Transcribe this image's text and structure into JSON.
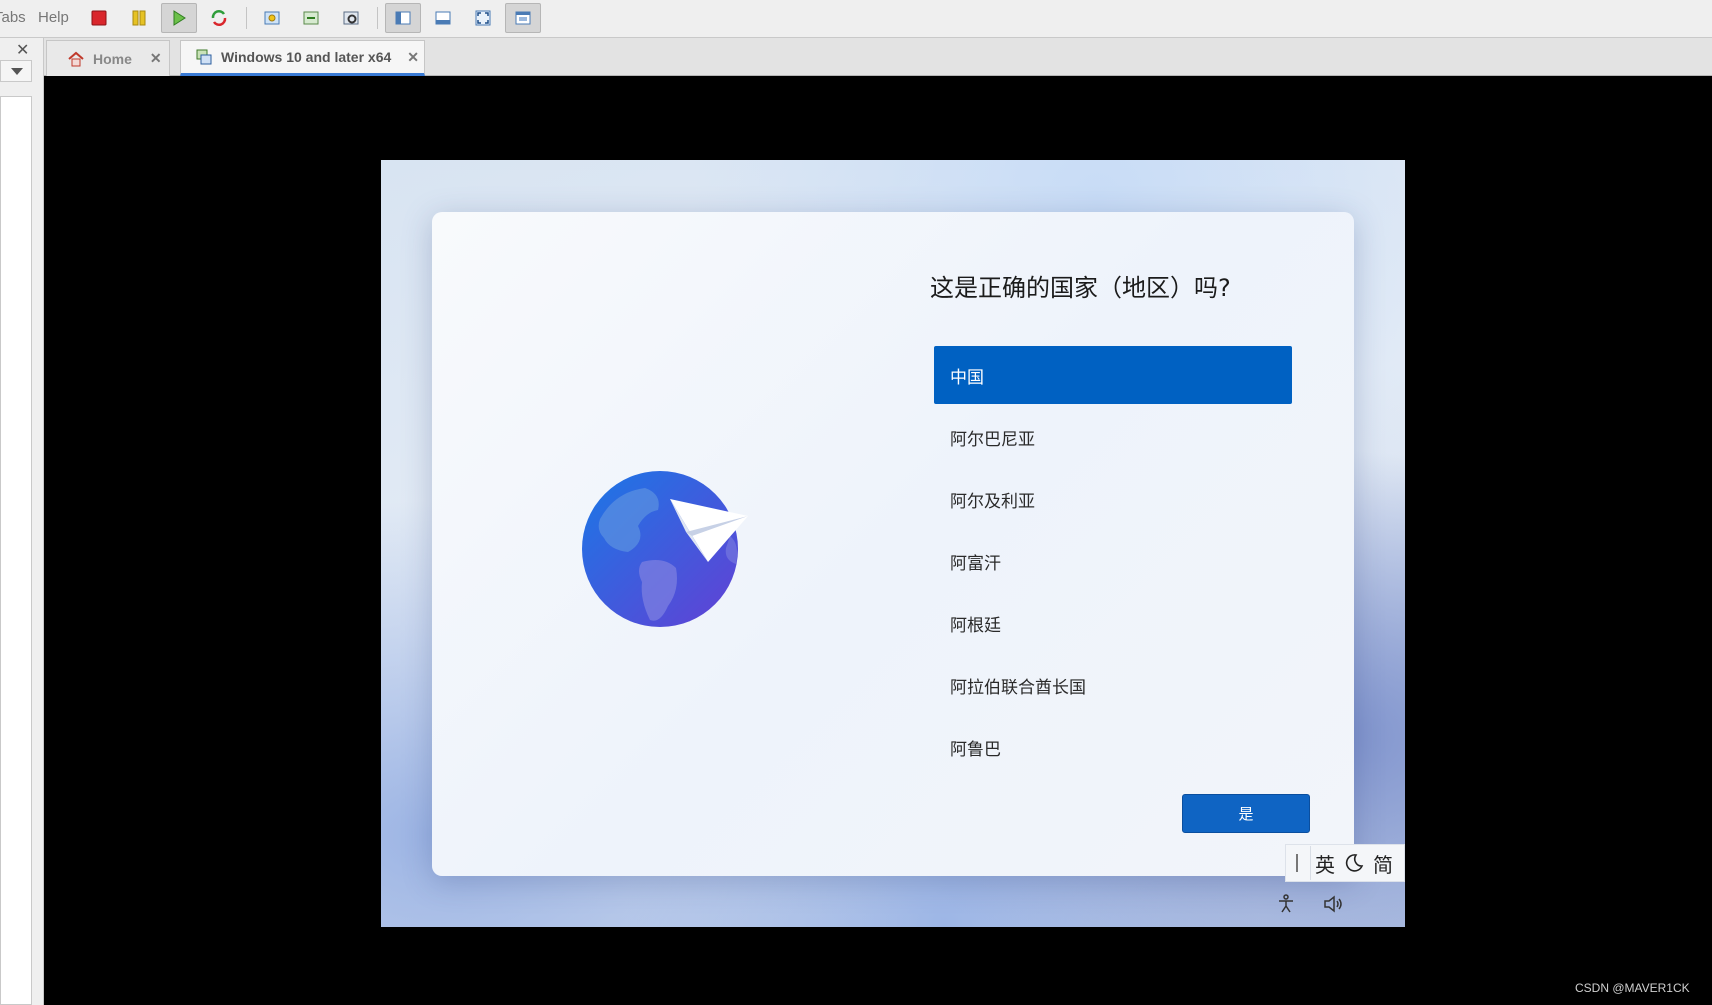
{
  "menu": {
    "tabs_label": "Tabs",
    "help_label": "Help"
  },
  "toolbar_icons": [
    "stop-icon",
    "pause-icon",
    "play-icon",
    "restart-icon",
    "snapshot-icon",
    "snapshot-manager-icon",
    "settings-icon",
    "sidebar-view-icon",
    "console-view-icon",
    "fullscreen-icon",
    "unity-view-icon"
  ],
  "tabs": [
    {
      "label": "Home",
      "icon": "home-icon",
      "active": false
    },
    {
      "label": "Windows 10 and later x64",
      "icon": "vm-icon",
      "active": true
    }
  ],
  "setup": {
    "question": "这是正确的国家（地区）吗?",
    "countries": [
      "中国",
      "阿尔巴尼亚",
      "阿尔及利亚",
      "阿富汗",
      "阿根廷",
      "阿拉伯联合酋长国",
      "阿鲁巴"
    ],
    "selected_index": 0,
    "yes_label": "是"
  },
  "ime": {
    "mode": "英",
    "script": "简"
  },
  "watermark": "CSDN @MAVER1CK",
  "colors": {
    "accent": "#0061c2",
    "button": "#0f64c3",
    "stop": "#d9262c",
    "pause": "#e6c224",
    "play": "#4caf50"
  }
}
